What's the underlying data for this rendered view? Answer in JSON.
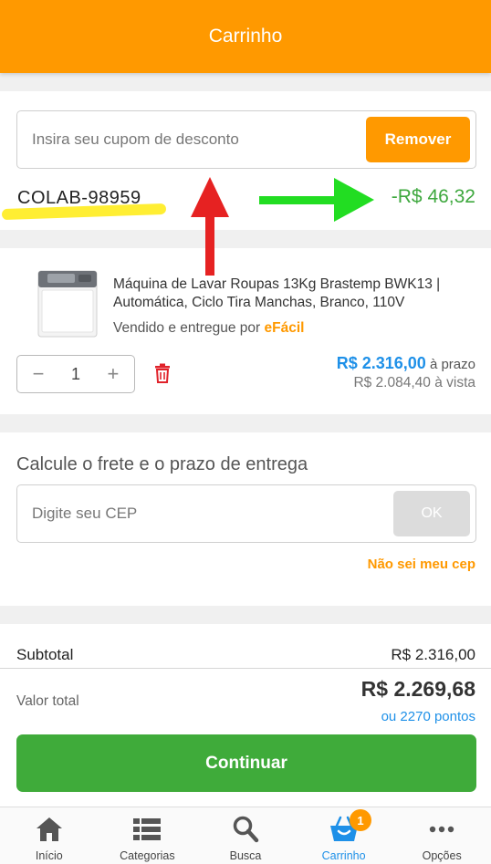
{
  "header": {
    "title": "Carrinho"
  },
  "coupon": {
    "placeholder": "Insira seu cupom de desconto",
    "remove_label": "Remover",
    "code": "COLAB-98959",
    "discount": "-R$ 46,32"
  },
  "product": {
    "name": "Máquina de Lavar Roupas 13Kg Brastemp BWK13 | Automática, Ciclo Tira Manchas, Branco, 110V",
    "seller_prefix": "Vendido e entregue por",
    "seller_name": "eFácil",
    "quantity": "1",
    "price": "R$ 2.316,00",
    "price_suffix": "à prazo",
    "price_cash": "R$ 2.084,40 à vista"
  },
  "shipping": {
    "title": "Calcule o frete e o prazo de entrega",
    "cep_placeholder": "Digite seu CEP",
    "ok_label": "OK",
    "no_cep_link": "Não sei meu cep"
  },
  "totals": {
    "subtotal_label": "Subtotal",
    "subtotal_value": "R$ 2.316,00",
    "total_label": "Valor total",
    "total_value": "R$ 2.269,68",
    "points": "ou 2270 pontos",
    "continue_label": "Continuar"
  },
  "tabbar": {
    "items": [
      {
        "label": "Início",
        "icon": "home-icon"
      },
      {
        "label": "Categorias",
        "icon": "list-icon"
      },
      {
        "label": "Busca",
        "icon": "search-icon"
      },
      {
        "label": "Carrinho",
        "icon": "basket-icon",
        "badge": "1",
        "active": true
      },
      {
        "label": "Opções",
        "icon": "more-icon"
      }
    ]
  },
  "colors": {
    "brand_orange": "#ff9900",
    "accent_blue": "#1e90e8",
    "success_green": "#3fab3a",
    "annotation_red": "#e62222",
    "annotation_green": "#22dd22",
    "annotation_yellow": "#ffee33"
  }
}
